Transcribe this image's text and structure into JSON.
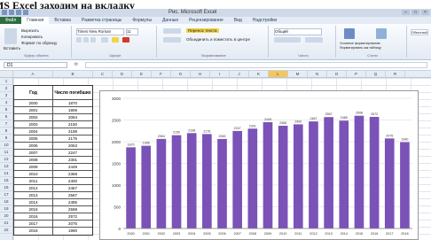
{
  "caption": "рамма: В MS Excel заходим на вкладку",
  "window": {
    "title": "Рис. Microsoft Excel",
    "min": "–",
    "max": "□",
    "close": "×"
  },
  "tabs": [
    "Файл",
    "Главная",
    "Вставка",
    "Разметка страницы",
    "Формулы",
    "Данные",
    "Рецензирование",
    "Вид",
    "Надстройки"
  ],
  "ribbon": {
    "clipboard": {
      "paste": "Вставить",
      "cut": "Вырезать",
      "copy": "Копировать",
      "format": "Формат по образцу",
      "label": "Буфер обмена"
    },
    "font": {
      "name": "Times New Roman",
      "size": "11",
      "label": "Шрифт"
    },
    "alignment": {
      "wrap": "Перенос текста",
      "merge": "Объединить и поместить в центре",
      "label": "Выравнивание"
    },
    "number": {
      "format": "Общий",
      "label": "Число"
    },
    "styles": {
      "conditional": "Условное форматирование",
      "table": "Форматировать как таблицу",
      "label": "Стили"
    },
    "cells": {
      "label": "Обычный"
    }
  },
  "formula_bar": {
    "name_box": "D1",
    "fx": "fx",
    "value": ""
  },
  "columns": [
    "A",
    "B",
    "C",
    "D",
    "E",
    "F",
    "G",
    "H",
    "I",
    "J",
    "K",
    "L",
    "M",
    "N",
    "O",
    "P",
    "Q",
    "R"
  ],
  "selected_column": "L",
  "row_numbers": [
    "1",
    "2",
    "3",
    "4",
    "5",
    "6",
    "7",
    "8",
    "9",
    "10",
    "11",
    "12",
    "13",
    "14",
    "15",
    "16",
    "17",
    "18",
    "19",
    "20",
    "21",
    "22"
  ],
  "table": {
    "headers": [
      "Год",
      "Число погибших"
    ],
    "rows": [
      [
        "2000",
        "1870"
      ],
      [
        "2001",
        "1906"
      ],
      [
        "2002",
        "2064"
      ],
      [
        "2003",
        "2150"
      ],
      [
        "2004",
        "2198"
      ],
      [
        "2005",
        "2176"
      ],
      [
        "2006",
        "2063"
      ],
      [
        "2007",
        "2247"
      ],
      [
        "2008",
        "2301"
      ],
      [
        "2009",
        "2449"
      ],
      [
        "2010",
        "2368"
      ],
      [
        "2011",
        "2400"
      ],
      [
        "2012",
        "2467"
      ],
      [
        "2013",
        "2567"
      ],
      [
        "2014",
        "2485"
      ],
      [
        "2015",
        "2598"
      ],
      [
        "2016",
        "2572"
      ],
      [
        "2017",
        "2075"
      ],
      [
        "2018",
        "1990"
      ]
    ]
  },
  "chart_data": {
    "type": "bar",
    "categories": [
      "2000",
      "2001",
      "2002",
      "2003",
      "2004",
      "2005",
      "2006",
      "2007",
      "2008",
      "2009",
      "2010",
      "2011",
      "2012",
      "2013",
      "2014",
      "2015",
      "2016",
      "2017",
      "2018"
    ],
    "values": [
      1870,
      1906,
      2064,
      2150,
      2198,
      2176,
      2063,
      2247,
      2301,
      2449,
      2368,
      2400,
      2467,
      2567,
      2485,
      2598,
      2572,
      2075,
      1990
    ],
    "ylim": [
      0,
      3000
    ],
    "yticks": [
      "3000",
      "2500",
      "2000",
      "1500",
      "1000",
      "500",
      "0"
    ],
    "bar_color": "#7b52b8",
    "grid": true,
    "title": "",
    "xlabel": "",
    "ylabel": ""
  }
}
